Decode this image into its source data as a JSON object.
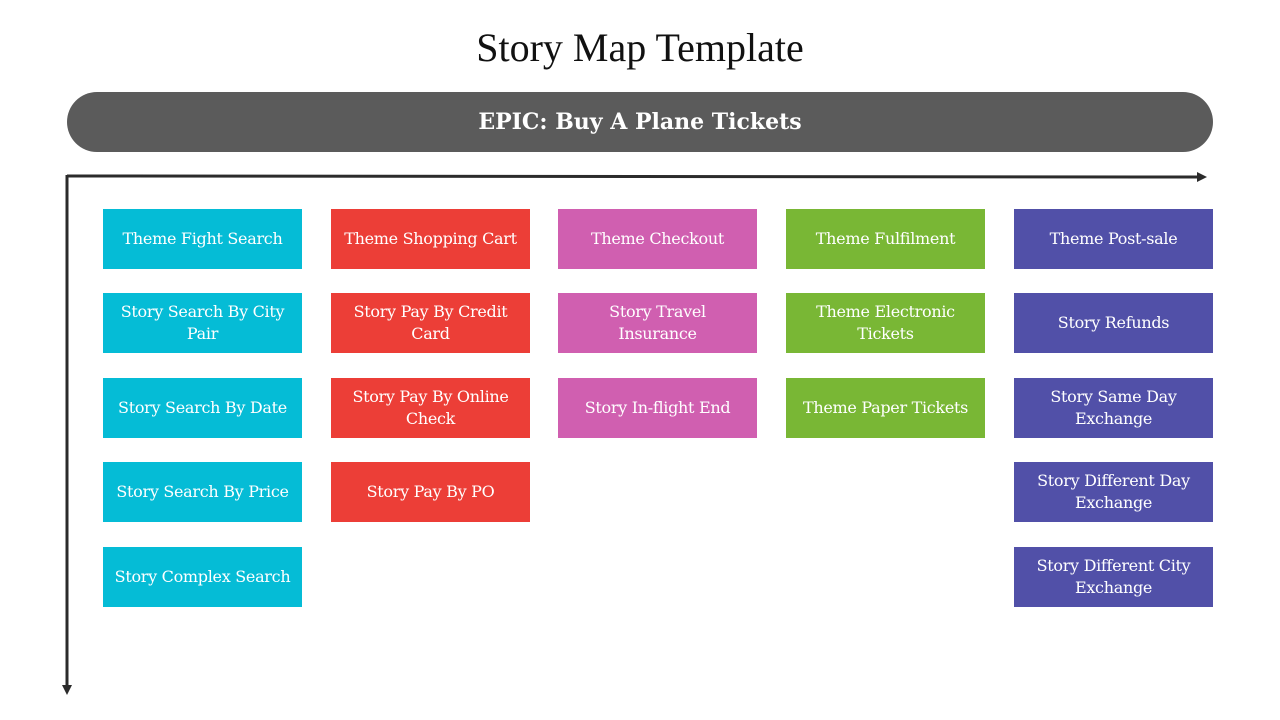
{
  "title": "Story Map Template",
  "epic": {
    "label": "EPIC: Buy A Plane Tickets",
    "color": "#5b5b5b"
  },
  "columns": [
    {
      "color": "#05bcd6",
      "cards": [
        "Theme Fight Search",
        "Story Search By City Pair",
        "Story Search By Date",
        "Story Search By Price",
        "Story Complex Search"
      ]
    },
    {
      "color": "#ec3e37",
      "cards": [
        "Theme Shopping Cart",
        "Story Pay By Credit Card",
        "Story Pay By Online Check",
        "Story Pay By PO"
      ]
    },
    {
      "color": "#d05fb0",
      "cards": [
        "Theme Checkout",
        "Story Travel Insurance",
        "Story In-flight End"
      ]
    },
    {
      "color": "#79b735",
      "cards": [
        "Theme Fulfilment",
        "Theme Electronic Tickets",
        "Theme Paper Tickets"
      ]
    },
    {
      "color": "#5150a8",
      "cards": [
        "Theme Post-sale",
        "Story Refunds",
        "Story Same Day Exchange",
        "Story Different Day Exchange",
        "Story Different City Exchange"
      ]
    }
  ]
}
